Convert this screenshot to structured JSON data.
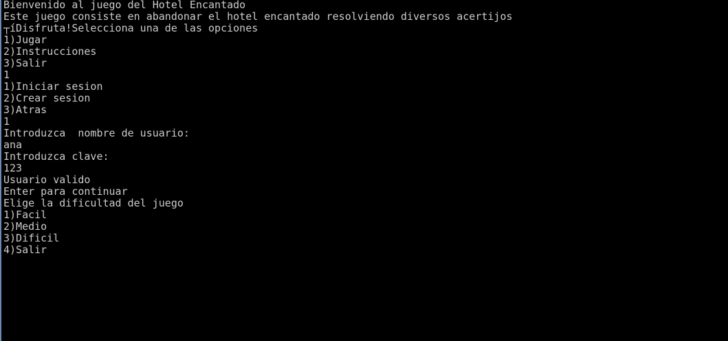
{
  "console": {
    "lines": [
      "Bienvenido al juego del Hotel Encantado",
      "Este juego consiste en abandonar el hotel encantado resolviendo diversos acertijos",
      "┬íDisfruta!Selecciona una de las opciones",
      "1)Jugar",
      "2)Instrucciones",
      "3)Salir",
      "1",
      "1)Iniciar sesion",
      "2)Crear sesion",
      "3)Atras",
      "1",
      "Introduzca  nombre de usuario:",
      "ana",
      "Introduzca clave:",
      "123",
      "Usuario valido",
      "Enter para continuar",
      "Elige la dificultad del juego",
      "1)Facil",
      "2)Medio",
      "3)Dificil",
      "4)Salir"
    ]
  }
}
